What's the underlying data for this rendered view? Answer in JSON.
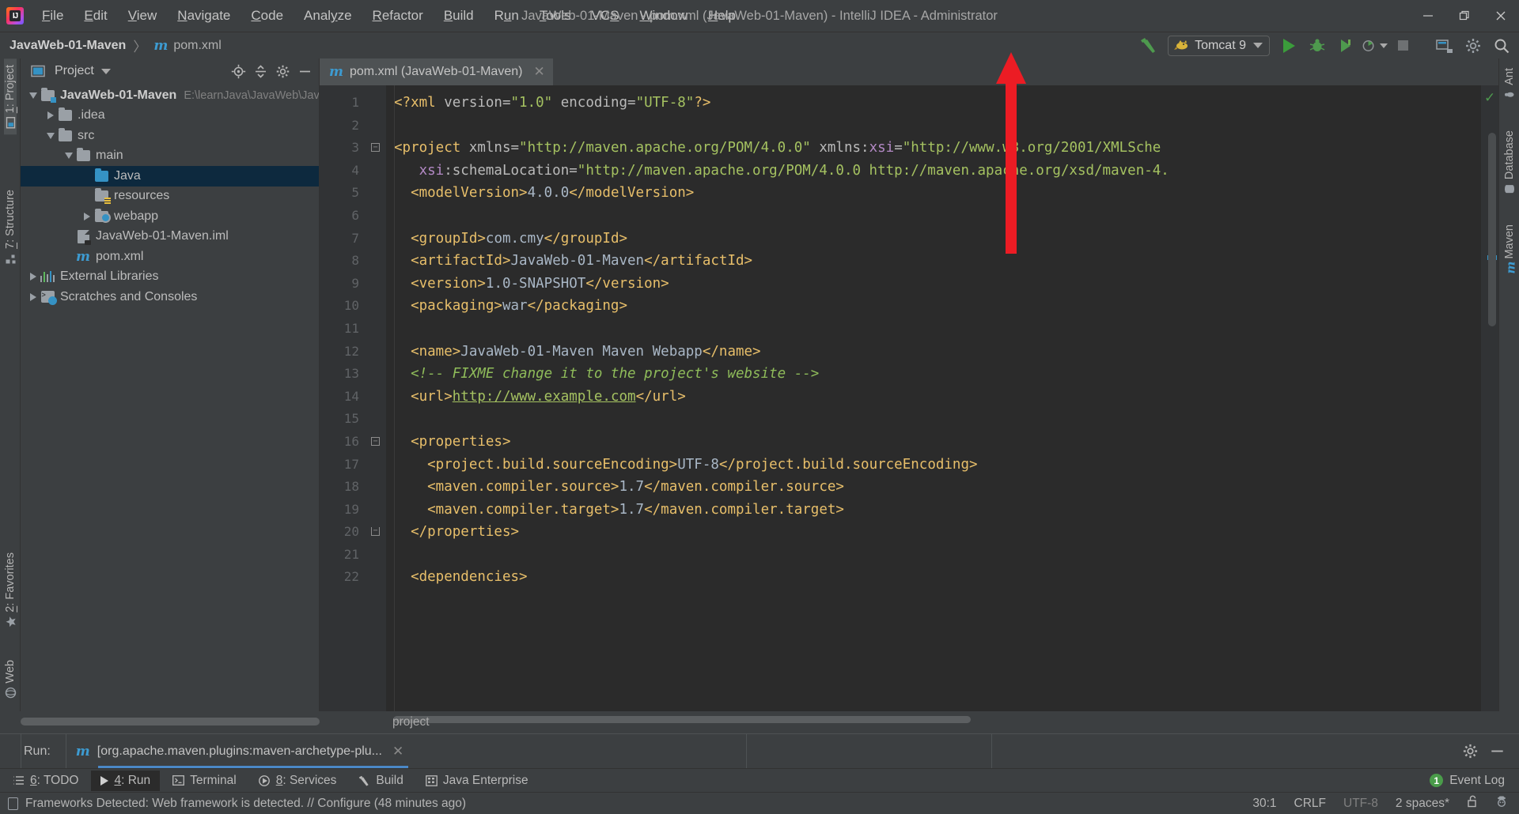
{
  "window": {
    "title": "JavaWeb-01-Maven - pom.xml (JavaWeb-01-Maven) - IntelliJ IDEA - Administrator",
    "minimize_label": "─",
    "maximize_label": "❐",
    "close_label": "✕",
    "logo_text": "IJ"
  },
  "menu": [
    {
      "label": "File",
      "mnemonic": "F"
    },
    {
      "label": "Edit",
      "mnemonic": "E"
    },
    {
      "label": "View",
      "mnemonic": "V"
    },
    {
      "label": "Navigate",
      "mnemonic": "N"
    },
    {
      "label": "Code",
      "mnemonic": "C"
    },
    {
      "label": "Analyze",
      "mnemonic": "y"
    },
    {
      "label": "Refactor",
      "mnemonic": "R"
    },
    {
      "label": "Build",
      "mnemonic": "B"
    },
    {
      "label": "Run",
      "mnemonic": "u"
    },
    {
      "label": "Tools",
      "mnemonic": "T"
    },
    {
      "label": "VCS",
      "mnemonic": "S"
    },
    {
      "label": "Window",
      "mnemonic": "W"
    },
    {
      "label": "Help",
      "mnemonic": "H"
    }
  ],
  "navbar": {
    "project_crumb": "JavaWeb-01-Maven",
    "separator": "〉",
    "file_icon": "m",
    "file_crumb": "pom.xml"
  },
  "toolbar": {
    "build_label": "Build",
    "run_config": "Tomcat 9",
    "run_label": "Run",
    "debug_label": "Debug",
    "run_coverage_label": "Run with Coverage",
    "profiler_label": "Profiler",
    "stop_label": "Stop",
    "updates_label": "Update Running Application",
    "search_label": "Search Everywhere",
    "settings_label": "Settings"
  },
  "left_strip": [
    {
      "label": "1: Project",
      "num": "1",
      "active": true,
      "icon": "project-icon"
    },
    {
      "label": "7: Structure",
      "num": "7",
      "active": false,
      "icon": "structure-icon"
    },
    {
      "label": "2: Favorites",
      "num": "2",
      "active": false,
      "icon": "star-icon"
    },
    {
      "label": "Web",
      "num": "",
      "active": false,
      "icon": "web-icon"
    }
  ],
  "right_strip": [
    {
      "label": "Ant",
      "icon": "ant-icon"
    },
    {
      "label": "Database",
      "icon": "database-icon"
    },
    {
      "label": "Maven",
      "icon": "maven-icon"
    }
  ],
  "project_panel": {
    "title": "Project",
    "locate_icon": "locate-icon",
    "collapse_icon": "collapse-all-icon",
    "settings_icon": "gear-icon",
    "hide_icon": "hide-icon",
    "tree": [
      {
        "label": "JavaWeb-01-Maven",
        "path": "E:\\learnJava\\JavaWeb\\JavaW",
        "depth": 0,
        "expanded": true,
        "bold": true,
        "icon": "module-folder-icon",
        "selected": false
      },
      {
        "label": ".idea",
        "path": "",
        "depth": 1,
        "expanded": false,
        "bold": false,
        "icon": "folder-icon",
        "selected": false
      },
      {
        "label": "src",
        "path": "",
        "depth": 1,
        "expanded": true,
        "bold": false,
        "icon": "folder-icon",
        "selected": false
      },
      {
        "label": "main",
        "path": "",
        "depth": 2,
        "expanded": true,
        "bold": false,
        "icon": "folder-icon",
        "selected": false
      },
      {
        "label": "Java",
        "path": "",
        "depth": 3,
        "expanded": null,
        "bold": false,
        "icon": "source-folder-icon",
        "selected": true
      },
      {
        "label": "resources",
        "path": "",
        "depth": 3,
        "expanded": null,
        "bold": false,
        "icon": "resources-folder-icon",
        "selected": false
      },
      {
        "label": "webapp",
        "path": "",
        "depth": 3,
        "expanded": false,
        "bold": false,
        "icon": "web-folder-icon",
        "selected": false
      },
      {
        "label": "JavaWeb-01-Maven.iml",
        "path": "",
        "depth": 2,
        "expanded": null,
        "bold": false,
        "icon": "iml-file-icon",
        "selected": false
      },
      {
        "label": "pom.xml",
        "path": "",
        "depth": 2,
        "expanded": null,
        "bold": false,
        "icon": "maven-file-icon",
        "selected": false
      },
      {
        "label": "External Libraries",
        "path": "",
        "depth": 0,
        "expanded": false,
        "bold": false,
        "icon": "libraries-icon",
        "selected": false
      },
      {
        "label": "Scratches and Consoles",
        "path": "",
        "depth": 0,
        "expanded": false,
        "bold": false,
        "icon": "scratches-icon",
        "selected": false
      }
    ]
  },
  "editor": {
    "tab_label": "pom.xml (JavaWeb-01-Maven)",
    "tab_icon": "m",
    "tab_close": "✕",
    "breadcrumb": "project",
    "inspection_status": "✓",
    "lines": [
      {
        "n": "1",
        "fold": "",
        "tokens": [
          {
            "t": "tag",
            "v": "<?xml "
          },
          {
            "t": "attr",
            "v": "version="
          },
          {
            "t": "val",
            "v": "\"1.0\""
          },
          {
            "t": "attr",
            "v": " encoding="
          },
          {
            "t": "val",
            "v": "\"UTF-8\""
          },
          {
            "t": "tag",
            "v": "?>"
          }
        ]
      },
      {
        "n": "2",
        "fold": "",
        "tokens": []
      },
      {
        "n": "3",
        "fold": "start",
        "tokens": [
          {
            "t": "tag",
            "v": "<project "
          },
          {
            "t": "attr",
            "v": "xmlns="
          },
          {
            "t": "val",
            "v": "\"http://maven.apache.org/POM/4.0.0\""
          },
          {
            "t": "attr",
            "v": " xmlns:"
          },
          {
            "t": "ns",
            "v": "xsi"
          },
          {
            "t": "attr",
            "v": "="
          },
          {
            "t": "val",
            "v": "\"http://www.w3.org/2001/XMLSche"
          }
        ]
      },
      {
        "n": "4",
        "fold": "",
        "tokens": [
          {
            "t": "attr",
            "v": "   "
          },
          {
            "t": "ns",
            "v": "xsi"
          },
          {
            "t": "attr",
            "v": ":schemaLocation="
          },
          {
            "t": "val",
            "v": "\"http://maven.apache.org/POM/4.0.0 http://maven.apache.org/xsd/maven-4."
          }
        ]
      },
      {
        "n": "5",
        "fold": "",
        "tokens": [
          {
            "t": "tag",
            "v": "  <modelVersion>"
          },
          {
            "t": "txt",
            "v": "4.0.0"
          },
          {
            "t": "tag",
            "v": "</modelVersion>"
          }
        ]
      },
      {
        "n": "6",
        "fold": "",
        "tokens": []
      },
      {
        "n": "7",
        "fold": "",
        "tokens": [
          {
            "t": "tag",
            "v": "  <groupId>"
          },
          {
            "t": "txt",
            "v": "com.cmy"
          },
          {
            "t": "tag",
            "v": "</groupId>"
          }
        ]
      },
      {
        "n": "8",
        "fold": "",
        "tokens": [
          {
            "t": "tag",
            "v": "  <artifactId>"
          },
          {
            "t": "txt",
            "v": "JavaWeb-01-Maven"
          },
          {
            "t": "tag",
            "v": "</artifactId>"
          }
        ]
      },
      {
        "n": "9",
        "fold": "",
        "tokens": [
          {
            "t": "tag",
            "v": "  <version>"
          },
          {
            "t": "txt",
            "v": "1.0-SNAPSHOT"
          },
          {
            "t": "tag",
            "v": "</version>"
          }
        ]
      },
      {
        "n": "10",
        "fold": "",
        "tokens": [
          {
            "t": "tag",
            "v": "  <packaging>"
          },
          {
            "t": "txt",
            "v": "war"
          },
          {
            "t": "tag",
            "v": "</packaging>"
          }
        ]
      },
      {
        "n": "11",
        "fold": "",
        "tokens": []
      },
      {
        "n": "12",
        "fold": "",
        "tokens": [
          {
            "t": "tag",
            "v": "  <name>"
          },
          {
            "t": "txt",
            "v": "JavaWeb-01-Maven Maven Webapp"
          },
          {
            "t": "tag",
            "v": "</name>"
          }
        ]
      },
      {
        "n": "13",
        "fold": "",
        "tokens": [
          {
            "t": "cmt",
            "v": "  <!-- FIXME change it to the project's website -->"
          }
        ]
      },
      {
        "n": "14",
        "fold": "",
        "tokens": [
          {
            "t": "tag",
            "v": "  <url>"
          },
          {
            "t": "link",
            "v": "http://www.example.com"
          },
          {
            "t": "tag",
            "v": "</url>"
          }
        ]
      },
      {
        "n": "15",
        "fold": "",
        "tokens": []
      },
      {
        "n": "16",
        "fold": "start",
        "tokens": [
          {
            "t": "tag",
            "v": "  <properties>"
          }
        ]
      },
      {
        "n": "17",
        "fold": "",
        "tokens": [
          {
            "t": "tag",
            "v": "    <project.build.sourceEncoding>"
          },
          {
            "t": "txt",
            "v": "UTF-8"
          },
          {
            "t": "tag",
            "v": "</project.build.sourceEncoding>"
          }
        ]
      },
      {
        "n": "18",
        "fold": "",
        "tokens": [
          {
            "t": "tag",
            "v": "    <maven.compiler.source>"
          },
          {
            "t": "txt",
            "v": "1.7"
          },
          {
            "t": "tag",
            "v": "</maven.compiler.source>"
          }
        ]
      },
      {
        "n": "19",
        "fold": "",
        "tokens": [
          {
            "t": "tag",
            "v": "    <maven.compiler.target>"
          },
          {
            "t": "txt",
            "v": "1.7"
          },
          {
            "t": "tag",
            "v": "</maven.compiler.target>"
          }
        ]
      },
      {
        "n": "20",
        "fold": "end",
        "tokens": [
          {
            "t": "tag",
            "v": "  </properties>"
          }
        ]
      },
      {
        "n": "21",
        "fold": "",
        "tokens": []
      },
      {
        "n": "22",
        "fold": "",
        "tokens": [
          {
            "t": "tag",
            "v": "  <dependencies>"
          }
        ]
      }
    ]
  },
  "run_panel": {
    "run_label": "Run:",
    "tab_icon": "m",
    "tab_label": "[org.apache.maven.plugins:maven-archetype-plu...",
    "tab_close": "✕",
    "settings_icon": "gear-icon",
    "hide_icon": "hide-icon"
  },
  "tool_windows": [
    {
      "label": "6: TODO",
      "num": "6",
      "icon": "todo-icon",
      "active": false
    },
    {
      "label": "4: Run",
      "num": "4",
      "icon": "run-icon",
      "active": true
    },
    {
      "label": "Terminal",
      "num": "",
      "icon": "terminal-icon",
      "active": false
    },
    {
      "label": "8: Services",
      "num": "8",
      "icon": "services-icon",
      "active": false
    },
    {
      "label": "Build",
      "num": "",
      "icon": "build-icon",
      "active": false
    },
    {
      "label": "Java Enterprise",
      "num": "",
      "icon": "java-enterprise-icon",
      "active": false
    }
  ],
  "event_log": {
    "count": "1",
    "label": "Event Log"
  },
  "status_bar": {
    "message": "Frameworks Detected: Web framework is detected. // Configure (48 minutes ago)",
    "caret": "30:1",
    "line_separator": "CRLF",
    "encoding": "UTF-8",
    "indent": "2 spaces*",
    "lock_icon": "unlocked-icon",
    "inspector_icon": "hector-icon"
  },
  "colors": {
    "accent_blue": "#3592c4",
    "selection": "#0d293e",
    "green_run": "#3b9c3b",
    "arrow_red": "#ec1c24",
    "tag": "#e8bf6a",
    "value": "#a5c261",
    "comment": "#8fbc5a",
    "namespace": "#b389c5"
  }
}
